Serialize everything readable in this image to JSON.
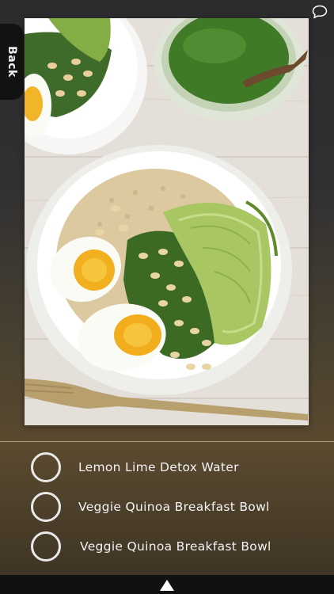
{
  "nav": {
    "back_label": "Back"
  },
  "icons": {
    "comment": "speech-bubble-icon",
    "expand": "arrow-up-icon"
  },
  "quiz": {
    "options": [
      {
        "label": "Lemon Lime Detox Water"
      },
      {
        "label": "Veggie Quinoa Breakfast Bowl"
      },
      {
        "label": "Veggie Quinoa Breakfast Bowl"
      }
    ]
  }
}
